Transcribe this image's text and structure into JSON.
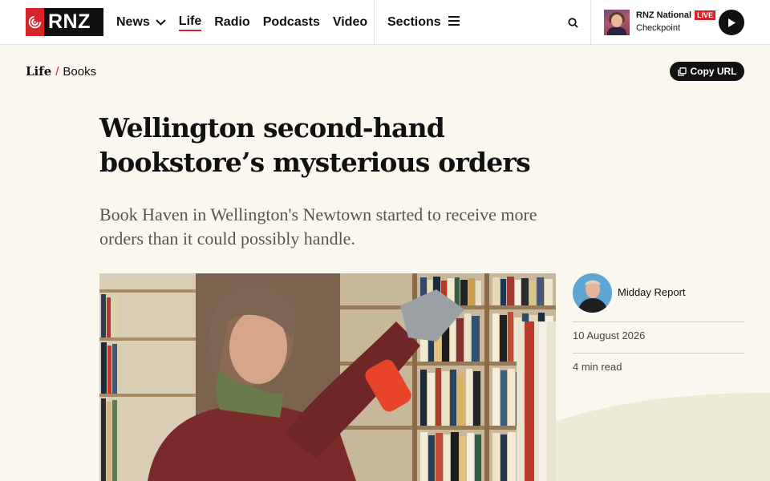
{
  "header": {
    "logo_text": "RNZ",
    "nav": [
      {
        "label": "News",
        "has_dropdown": true
      },
      {
        "label": "Life",
        "active": true
      },
      {
        "label": "Radio"
      },
      {
        "label": "Podcasts"
      },
      {
        "label": "Video"
      }
    ],
    "sections_label": "Sections",
    "live": {
      "station": "RNZ National",
      "badge": "LIVE",
      "program": "Checkpoint"
    }
  },
  "breadcrumb": {
    "parent": "Life",
    "separator": "/",
    "current": "Books"
  },
  "copy_url_label": "Copy URL",
  "article": {
    "headline": "Wellington second-hand bookstore’s mysterious orders",
    "standfirst": "Book Haven in Wellington's Newtown started to receive more orders than it could possibly handle.",
    "author": "Midday Report",
    "date": "10 August 2026",
    "read_time": "4 min read"
  },
  "colors": {
    "accent_red": "#d8232a",
    "page_bg": "#faf7ee",
    "wave": "#ecebd4"
  }
}
